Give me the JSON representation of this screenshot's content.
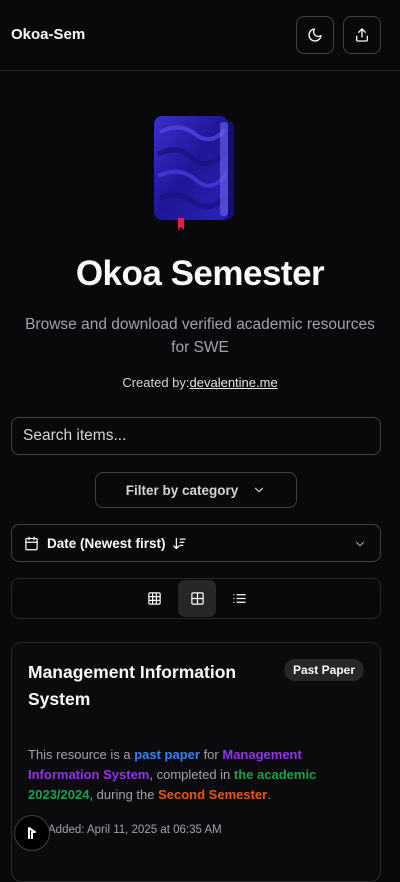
{
  "header": {
    "brand": "Okoa-Sem",
    "theme_icon": "moon-icon",
    "share_icon": "upload-icon"
  },
  "hero": {
    "title": "Okoa Semester",
    "description": "Browse and download verified academic resources for SWE",
    "created_by_label": "Created by:",
    "created_by_link": "devalentine.me"
  },
  "search": {
    "placeholder": "Search items..."
  },
  "filter": {
    "label": "Filter by category"
  },
  "sort": {
    "label": "Date (Newest first)"
  },
  "views": [
    "grid-small-icon",
    "grid-large-icon",
    "list-icon"
  ],
  "card": {
    "title": "Management Information System",
    "badge": "Past Paper",
    "desc_prefix": "This resource is a ",
    "desc_type": "past paper",
    "desc_for": " for ",
    "desc_course": "Management Information System",
    "desc_completed": ", completed in ",
    "desc_year": "the academic 2023/2024",
    "desc_during": ", during the ",
    "desc_semester": "Second Semester",
    "desc_end": ".",
    "added": "Added: April 11, 2025 at 06:35 AM"
  },
  "colors": {
    "background": "#09090b",
    "type": "#3b82f6",
    "course": "#9333ea",
    "year": "#16a34a",
    "semester": "#ea580c",
    "book": "#2a1fa8"
  }
}
